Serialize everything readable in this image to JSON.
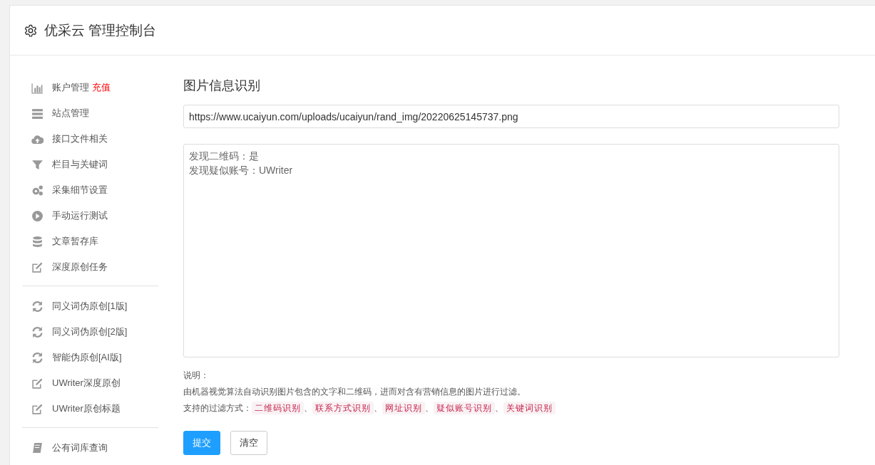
{
  "header": {
    "title": "优采云 管理控制台"
  },
  "sidebar": {
    "groups": [
      {
        "items": [
          {
            "kind": "chart",
            "label": "账户管理",
            "badge": "充值"
          },
          {
            "kind": "server",
            "label": "站点管理"
          },
          {
            "kind": "cloud",
            "label": "接口文件相关"
          },
          {
            "kind": "filter",
            "label": "栏目与关键词"
          },
          {
            "kind": "gears",
            "label": "采集细节设置"
          },
          {
            "kind": "play",
            "label": "手动运行测试"
          },
          {
            "kind": "database",
            "label": "文章暂存库"
          },
          {
            "kind": "edit",
            "label": "深度原创任务"
          }
        ]
      },
      {
        "items": [
          {
            "kind": "refresh",
            "label": "同义词伪原创[1版]"
          },
          {
            "kind": "refresh",
            "label": "同义词伪原创[2版]"
          },
          {
            "kind": "refresh",
            "label": "智能伪原创[AI版]"
          },
          {
            "kind": "edit",
            "label": "UWriter深度原创"
          },
          {
            "kind": "edit",
            "label": "UWriter原创标题"
          }
        ]
      },
      {
        "items": [
          {
            "kind": "book",
            "label": "公有词库查询"
          }
        ]
      }
    ]
  },
  "main": {
    "title": "图片信息识别",
    "url_field": {
      "value": "https://www.ucaiyun.com/uploads/ucaiyun/rand_img/20220625145737.png"
    },
    "result_box": {
      "lines": [
        "发现二维码：是",
        "发现疑似账号：UWriter"
      ]
    },
    "notes": {
      "heading": "说明：",
      "description": "由机器视觉算法自动识别图片包含的文字和二维码，进而对含有营销信息的图片进行过滤。",
      "methods_label": "支持的过滤方式：",
      "separator": "、",
      "methods": [
        "二维码识别",
        "联系方式识别",
        "网址识别",
        "疑似账号识别",
        "关键词识别"
      ]
    },
    "buttons": [
      {
        "kind": "primary",
        "label": "提交"
      },
      {
        "kind": "default",
        "label": "清空"
      }
    ]
  }
}
